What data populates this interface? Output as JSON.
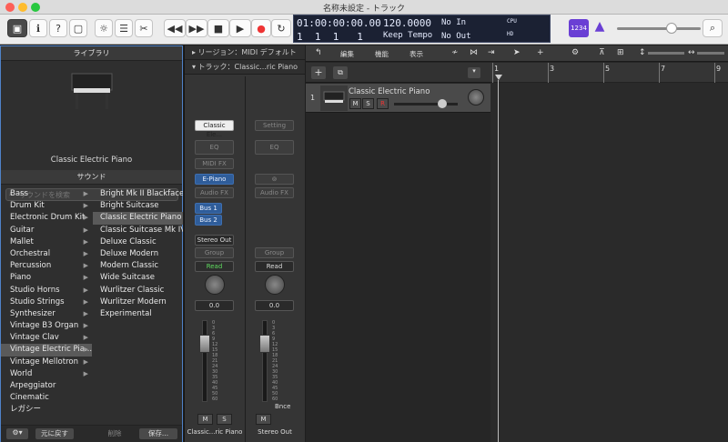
{
  "window": {
    "title": "名称未設定 - トラック"
  },
  "lcd": {
    "time": "01:00:00:00.00",
    "bars": "1  1  1   1",
    "tempo": "120.0000",
    "tempo_mode": "Keep Tempo",
    "in": "No In",
    "out": "No Out",
    "cpu": "CPU",
    "hd": "HD",
    "key": "1234"
  },
  "library": {
    "title": "ライブラリ",
    "patch_name": "Classic Electric Piano",
    "sound_label": "サウンド",
    "search_placeholder": "サウンドを検索",
    "categories": [
      "Bass",
      "Drum Kit",
      "Electronic Drum Kit",
      "Guitar",
      "Mallet",
      "Orchestral",
      "Percussion",
      "Piano",
      "Studio Horns",
      "Studio Strings",
      "Synthesizer",
      "Vintage B3 Organ",
      "Vintage Clav",
      "Vintage Electric Pia...",
      "Vintage Mellotron",
      "World",
      "Arpeggiator",
      "Cinematic",
      "レガシー"
    ],
    "presets": [
      "Bright Mk II Blackface",
      "Bright Suitcase",
      "Classic Electric Piano",
      "Classic Suitcase Mk IV",
      "Deluxe Classic",
      "Deluxe Modern",
      "Modern Classic",
      "Wide Suitcase",
      "Wurlitzer Classic",
      "Wurlitzer Modern",
      "Experimental"
    ],
    "revert": "元に戻す",
    "delete": "削除",
    "save": "保存..."
  },
  "inspector": {
    "region": "リージョン：MIDI デフォルト",
    "track": "トラック：Classic...ric Piano"
  },
  "strip1": {
    "setting": "Classic Ele...",
    "eq": "EQ",
    "midi_fx": "MIDI FX",
    "instrument": "E-Piano",
    "audio_fx": "Audio FX",
    "bus1": "Bus 1",
    "bus2": "Bus 2",
    "output": "Stereo Out",
    "group": "Group",
    "automation": "Read",
    "volume": "0.0",
    "mute": "M",
    "solo": "S",
    "name": "Classic...ric Piano"
  },
  "strip2": {
    "setting": "Setting",
    "eq": "EQ",
    "audio_fx": "Audio FX",
    "group": "Group",
    "automation": "Read",
    "volume": "0.0",
    "bounce": "Bnce",
    "mute": "M",
    "name": "Stereo Out"
  },
  "fader_scale": [
    "0",
    "3",
    "6",
    "9",
    "12",
    "15",
    "18",
    "21",
    "24",
    "30",
    "35",
    "40",
    "45",
    "50",
    "60"
  ],
  "menus": {
    "edit": "編集",
    "functions": "機能",
    "view": "表示"
  },
  "track": {
    "number": "1",
    "name": "Classic Electric Piano",
    "mute": "M",
    "solo": "S",
    "rec": "R"
  },
  "ruler": [
    "1",
    "3",
    "5",
    "7",
    "9"
  ]
}
